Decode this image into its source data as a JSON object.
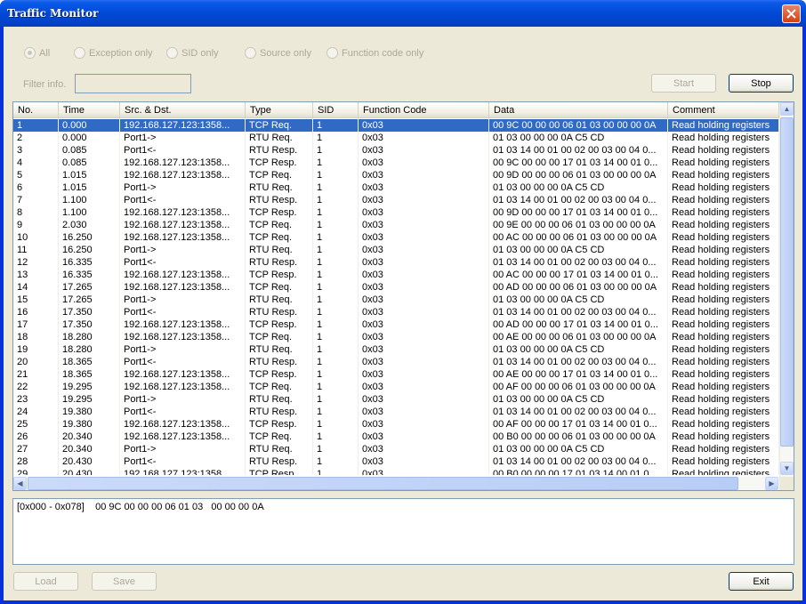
{
  "window": {
    "title": "Traffic Monitor"
  },
  "filters": {
    "radios": [
      {
        "label": "All",
        "selected": true
      },
      {
        "label": "Exception only",
        "selected": false
      },
      {
        "label": "SID only",
        "selected": false
      },
      {
        "label": "Source only",
        "selected": false
      },
      {
        "label": "Function code only",
        "selected": false
      }
    ],
    "filter_label": "Filter info.",
    "filter_value": ""
  },
  "buttons": {
    "start": "Start",
    "stop": "Stop",
    "load": "Load",
    "save": "Save",
    "exit": "Exit"
  },
  "table": {
    "columns": [
      "No.",
      "Time",
      "Src. & Dst.",
      "Type",
      "SID",
      "Function Code",
      "Data",
      "Comment"
    ],
    "selected_row": 0,
    "rows": [
      [
        "1",
        "0.000",
        "192.168.127.123:1358...",
        "TCP Req.",
        "1",
        "0x03",
        "00 9C 00 00 00 06 01 03 00 00 00 0A",
        "Read holding registers"
      ],
      [
        "2",
        "0.000",
        "Port1->",
        "RTU Req.",
        "1",
        "0x03",
        "01 03 00 00 00 0A C5 CD",
        "Read holding registers"
      ],
      [
        "3",
        "0.085",
        "Port1<-",
        "RTU Resp.",
        "1",
        "0x03",
        "01 03 14 00 01 00 02 00 03 00 04 0...",
        "Read holding registers"
      ],
      [
        "4",
        "0.085",
        "192.168.127.123:1358...",
        "TCP Resp.",
        "1",
        "0x03",
        "00 9C 00 00 00 17 01 03 14 00 01 0...",
        "Read holding registers"
      ],
      [
        "5",
        "1.015",
        "192.168.127.123:1358...",
        "TCP Req.",
        "1",
        "0x03",
        "00 9D 00 00 00 06 01 03 00 00 00 0A",
        "Read holding registers"
      ],
      [
        "6",
        "1.015",
        "Port1->",
        "RTU Req.",
        "1",
        "0x03",
        "01 03 00 00 00 0A C5 CD",
        "Read holding registers"
      ],
      [
        "7",
        "1.100",
        "Port1<-",
        "RTU Resp.",
        "1",
        "0x03",
        "01 03 14 00 01 00 02 00 03 00 04 0...",
        "Read holding registers"
      ],
      [
        "8",
        "1.100",
        "192.168.127.123:1358...",
        "TCP Resp.",
        "1",
        "0x03",
        "00 9D 00 00 00 17 01 03 14 00 01 0...",
        "Read holding registers"
      ],
      [
        "9",
        "2.030",
        "192.168.127.123:1358...",
        "TCP Req.",
        "1",
        "0x03",
        "00 9E 00 00 00 06 01 03 00 00 00 0A",
        "Read holding registers"
      ],
      [
        "10",
        "16.250",
        "192.168.127.123:1358...",
        "TCP Req.",
        "1",
        "0x03",
        "00 AC 00 00 00 06 01 03 00 00 00 0A",
        "Read holding registers"
      ],
      [
        "11",
        "16.250",
        "Port1->",
        "RTU Req.",
        "1",
        "0x03",
        "01 03 00 00 00 0A C5 CD",
        "Read holding registers"
      ],
      [
        "12",
        "16.335",
        "Port1<-",
        "RTU Resp.",
        "1",
        "0x03",
        "01 03 14 00 01 00 02 00 03 00 04 0...",
        "Read holding registers"
      ],
      [
        "13",
        "16.335",
        "192.168.127.123:1358...",
        "TCP Resp.",
        "1",
        "0x03",
        "00 AC 00 00 00 17 01 03 14 00 01 0...",
        "Read holding registers"
      ],
      [
        "14",
        "17.265",
        "192.168.127.123:1358...",
        "TCP Req.",
        "1",
        "0x03",
        "00 AD 00 00 00 06 01 03 00 00 00 0A",
        "Read holding registers"
      ],
      [
        "15",
        "17.265",
        "Port1->",
        "RTU Req.",
        "1",
        "0x03",
        "01 03 00 00 00 0A C5 CD",
        "Read holding registers"
      ],
      [
        "16",
        "17.350",
        "Port1<-",
        "RTU Resp.",
        "1",
        "0x03",
        "01 03 14 00 01 00 02 00 03 00 04 0...",
        "Read holding registers"
      ],
      [
        "17",
        "17.350",
        "192.168.127.123:1358...",
        "TCP Resp.",
        "1",
        "0x03",
        "00 AD 00 00 00 17 01 03 14 00 01 0...",
        "Read holding registers"
      ],
      [
        "18",
        "18.280",
        "192.168.127.123:1358...",
        "TCP Req.",
        "1",
        "0x03",
        "00 AE 00 00 00 06 01 03 00 00 00 0A",
        "Read holding registers"
      ],
      [
        "19",
        "18.280",
        "Port1->",
        "RTU Req.",
        "1",
        "0x03",
        "01 03 00 00 00 0A C5 CD",
        "Read holding registers"
      ],
      [
        "20",
        "18.365",
        "Port1<-",
        "RTU Resp.",
        "1",
        "0x03",
        "01 03 14 00 01 00 02 00 03 00 04 0...",
        "Read holding registers"
      ],
      [
        "21",
        "18.365",
        "192.168.127.123:1358...",
        "TCP Resp.",
        "1",
        "0x03",
        "00 AE 00 00 00 17 01 03 14 00 01 0...",
        "Read holding registers"
      ],
      [
        "22",
        "19.295",
        "192.168.127.123:1358...",
        "TCP Req.",
        "1",
        "0x03",
        "00 AF 00 00 00 06 01 03 00 00 00 0A",
        "Read holding registers"
      ],
      [
        "23",
        "19.295",
        "Port1->",
        "RTU Req.",
        "1",
        "0x03",
        "01 03 00 00 00 0A C5 CD",
        "Read holding registers"
      ],
      [
        "24",
        "19.380",
        "Port1<-",
        "RTU Resp.",
        "1",
        "0x03",
        "01 03 14 00 01 00 02 00 03 00 04 0...",
        "Read holding registers"
      ],
      [
        "25",
        "19.380",
        "192.168.127.123:1358...",
        "TCP Resp.",
        "1",
        "0x03",
        "00 AF 00 00 00 17 01 03 14 00 01 0...",
        "Read holding registers"
      ],
      [
        "26",
        "20.340",
        "192.168.127.123:1358...",
        "TCP Req.",
        "1",
        "0x03",
        "00 B0 00 00 00 06 01 03 00 00 00 0A",
        "Read holding registers"
      ],
      [
        "27",
        "20.340",
        "Port1->",
        "RTU Req.",
        "1",
        "0x03",
        "01 03 00 00 00 0A C5 CD",
        "Read holding registers"
      ],
      [
        "28",
        "20.430",
        "Port1<-",
        "RTU Resp.",
        "1",
        "0x03",
        "01 03 14 00 01 00 02 00 03 00 04 0...",
        "Read holding registers"
      ],
      [
        "29",
        "20.430",
        "192.168.127.123:1358...",
        "TCP Resp.",
        "1",
        "0x03",
        "00 B0 00 00 00 17 01 03 14 00 01 0...",
        "Read holding registers"
      ]
    ]
  },
  "detail": {
    "range": "[0x000 - 0x078]",
    "bytes": "00 9C 00 00 00 06 01 03   00 00 00 0A"
  },
  "colors": {
    "title_bar": "#0a5ae8",
    "selection": "#316ac5",
    "face": "#ece9d8"
  }
}
